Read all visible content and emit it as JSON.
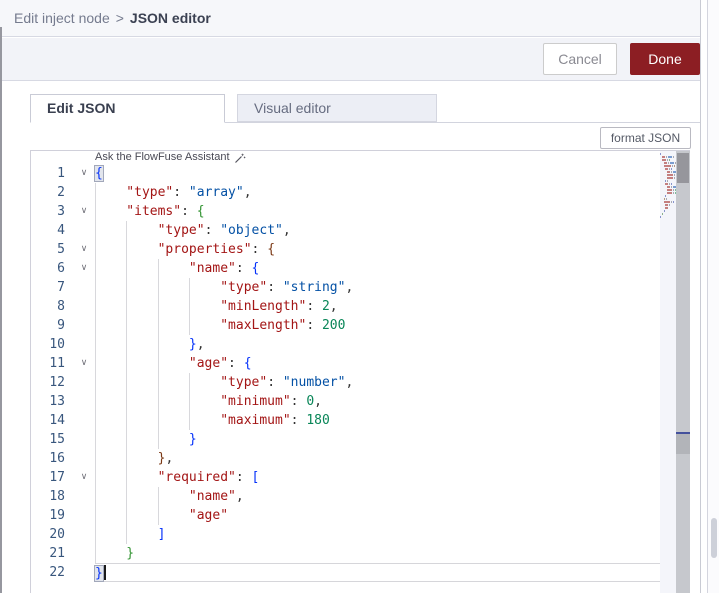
{
  "header": {
    "parent": "Edit inject node",
    "separator": ">",
    "current": "JSON editor"
  },
  "actions": {
    "cancel": "Cancel",
    "done": "Done"
  },
  "tabs": [
    {
      "label": "Edit JSON",
      "active": true
    },
    {
      "label": "Visual editor",
      "active": false
    }
  ],
  "editor_toolbar": {
    "format_json": "format JSON"
  },
  "assistant_hint": "Ask the FlowFuse Assistant",
  "colors": {
    "done_button": "#8C1E23",
    "json_key": "#A31515",
    "json_string": "#0451A5",
    "json_number": "#098658",
    "bracket_level1": "#0431FA",
    "bracket_level2": "#319331",
    "bracket_level3": "#7B3814"
  },
  "editor": {
    "language": "json",
    "lines": [
      {
        "n": 1,
        "ind": 0,
        "fold": true,
        "tokens": [
          {
            "t": "{",
            "c": "b1",
            "hl": true
          }
        ]
      },
      {
        "n": 2,
        "ind": 1,
        "tokens": [
          {
            "t": "\"type\"",
            "c": "k"
          },
          {
            "t": ": ",
            "c": "p"
          },
          {
            "t": "\"array\"",
            "c": "s"
          },
          {
            "t": ",",
            "c": "p"
          }
        ]
      },
      {
        "n": 3,
        "ind": 1,
        "fold": true,
        "tokens": [
          {
            "t": "\"items\"",
            "c": "k"
          },
          {
            "t": ": ",
            "c": "p"
          },
          {
            "t": "{",
            "c": "b2"
          }
        ]
      },
      {
        "n": 4,
        "ind": 2,
        "tokens": [
          {
            "t": "\"type\"",
            "c": "k"
          },
          {
            "t": ": ",
            "c": "p"
          },
          {
            "t": "\"object\"",
            "c": "s"
          },
          {
            "t": ",",
            "c": "p"
          }
        ]
      },
      {
        "n": 5,
        "ind": 2,
        "fold": true,
        "tokens": [
          {
            "t": "\"properties\"",
            "c": "k"
          },
          {
            "t": ": ",
            "c": "p"
          },
          {
            "t": "{",
            "c": "b3"
          }
        ]
      },
      {
        "n": 6,
        "ind": 3,
        "fold": true,
        "tokens": [
          {
            "t": "\"name\"",
            "c": "k"
          },
          {
            "t": ": ",
            "c": "p"
          },
          {
            "t": "{",
            "c": "b1"
          }
        ]
      },
      {
        "n": 7,
        "ind": 4,
        "tokens": [
          {
            "t": "\"type\"",
            "c": "k"
          },
          {
            "t": ": ",
            "c": "p"
          },
          {
            "t": "\"string\"",
            "c": "s"
          },
          {
            "t": ",",
            "c": "p"
          }
        ]
      },
      {
        "n": 8,
        "ind": 4,
        "tokens": [
          {
            "t": "\"minLength\"",
            "c": "k"
          },
          {
            "t": ": ",
            "c": "p"
          },
          {
            "t": "2",
            "c": "n"
          },
          {
            "t": ",",
            "c": "p"
          }
        ]
      },
      {
        "n": 9,
        "ind": 4,
        "tokens": [
          {
            "t": "\"maxLength\"",
            "c": "k"
          },
          {
            "t": ": ",
            "c": "p"
          },
          {
            "t": "200",
            "c": "n"
          }
        ]
      },
      {
        "n": 10,
        "ind": 3,
        "tokens": [
          {
            "t": "}",
            "c": "b1"
          },
          {
            "t": ",",
            "c": "p"
          }
        ]
      },
      {
        "n": 11,
        "ind": 3,
        "fold": true,
        "tokens": [
          {
            "t": "\"age\"",
            "c": "k"
          },
          {
            "t": ": ",
            "c": "p"
          },
          {
            "t": "{",
            "c": "b1"
          }
        ]
      },
      {
        "n": 12,
        "ind": 4,
        "tokens": [
          {
            "t": "\"type\"",
            "c": "k"
          },
          {
            "t": ": ",
            "c": "p"
          },
          {
            "t": "\"number\"",
            "c": "s"
          },
          {
            "t": ",",
            "c": "p"
          }
        ]
      },
      {
        "n": 13,
        "ind": 4,
        "tokens": [
          {
            "t": "\"minimum\"",
            "c": "k"
          },
          {
            "t": ": ",
            "c": "p"
          },
          {
            "t": "0",
            "c": "n"
          },
          {
            "t": ",",
            "c": "p"
          }
        ]
      },
      {
        "n": 14,
        "ind": 4,
        "tokens": [
          {
            "t": "\"maximum\"",
            "c": "k"
          },
          {
            "t": ": ",
            "c": "p"
          },
          {
            "t": "180",
            "c": "n"
          }
        ]
      },
      {
        "n": 15,
        "ind": 3,
        "tokens": [
          {
            "t": "}",
            "c": "b1"
          }
        ]
      },
      {
        "n": 16,
        "ind": 2,
        "tokens": [
          {
            "t": "}",
            "c": "b3"
          },
          {
            "t": ",",
            "c": "p"
          }
        ]
      },
      {
        "n": 17,
        "ind": 2,
        "fold": true,
        "tokens": [
          {
            "t": "\"required\"",
            "c": "k"
          },
          {
            "t": ": ",
            "c": "p"
          },
          {
            "t": "[",
            "c": "b1"
          }
        ]
      },
      {
        "n": 18,
        "ind": 3,
        "tokens": [
          {
            "t": "\"name\"",
            "c": "k"
          },
          {
            "t": ",",
            "c": "p"
          }
        ]
      },
      {
        "n": 19,
        "ind": 3,
        "tokens": [
          {
            "t": "\"age\"",
            "c": "k"
          }
        ]
      },
      {
        "n": 20,
        "ind": 2,
        "tokens": [
          {
            "t": "]",
            "c": "b1"
          }
        ]
      },
      {
        "n": 21,
        "ind": 1,
        "tokens": [
          {
            "t": "}",
            "c": "b2"
          }
        ]
      },
      {
        "n": 22,
        "ind": 0,
        "current": true,
        "cursorAfter": true,
        "tokens": [
          {
            "t": "}",
            "c": "b1",
            "hl": true
          }
        ]
      }
    ]
  }
}
